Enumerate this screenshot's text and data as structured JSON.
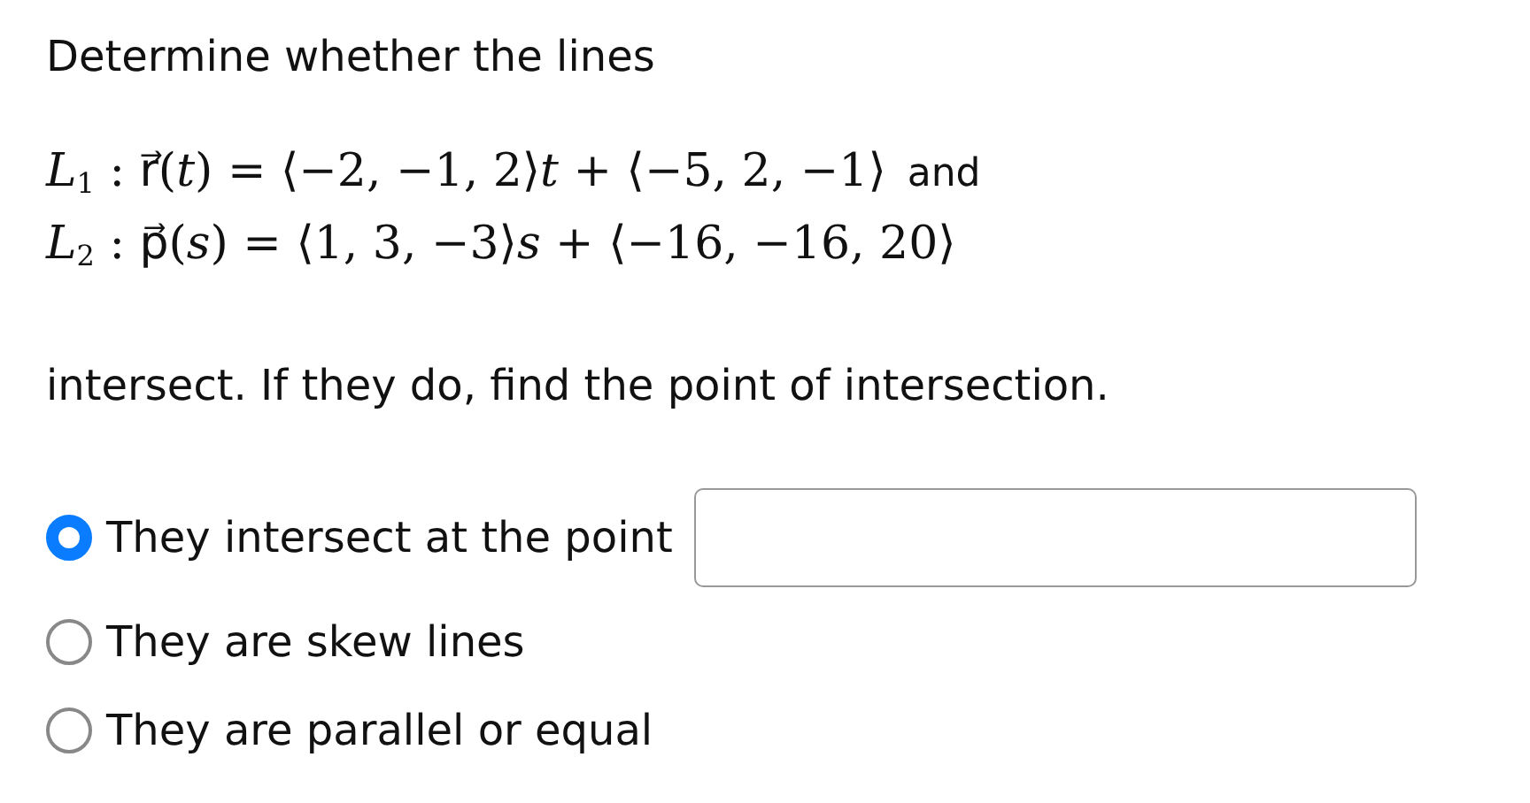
{
  "prompt": "Determine whether the lines",
  "equations": [
    {
      "math": "*L*$_{1}$ : r⃗(*t*) = ⟨−2, −1, 2⟩*t* + ⟨−5, 2, −1⟩",
      "suffix": "and"
    },
    {
      "math": "*L*$_{2}$ : p⃗(*s*) = ⟨1, 3, −3⟩*s* + ⟨−16, −16, 20⟩"
    }
  ],
  "instruction": "intersect. If they do, find the point of intersection.",
  "options": [
    {
      "label": "They intersect at the point",
      "selected": true,
      "kind": "with_field"
    },
    {
      "label": "They are skew lines",
      "selected": false,
      "kind": "plain"
    },
    {
      "label": "They are parallel or equal",
      "selected": false,
      "kind": "plain"
    }
  ]
}
